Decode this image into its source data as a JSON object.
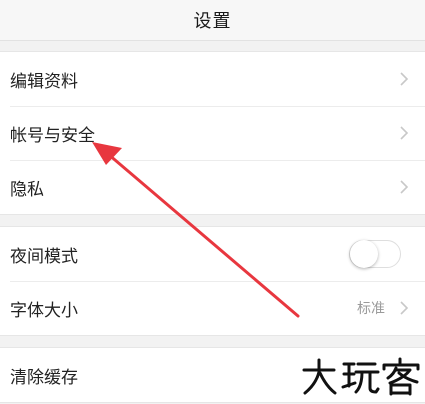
{
  "header": {
    "title": "设置"
  },
  "groups": [
    {
      "items": [
        {
          "label": "编辑资料"
        },
        {
          "label": "帐号与安全"
        },
        {
          "label": "隐私"
        }
      ]
    },
    {
      "items": [
        {
          "label": "夜间模式",
          "toggle_on": false
        },
        {
          "label": "字体大小",
          "value": "标准"
        }
      ]
    },
    {
      "items": [
        {
          "label": "清除缓存"
        }
      ]
    }
  ],
  "icons": {
    "chevron": "chevron-right-icon",
    "annotation": "red-arrow-annotation",
    "watermark": "dawanke-watermark-logo"
  },
  "watermark": {
    "text": "大玩客"
  },
  "colors": {
    "background": "#f2f2f2",
    "surface": "#ffffff",
    "chevron": "#c8c8c8",
    "secondary_text": "#9a9a9a",
    "annotation": "#e8373f"
  }
}
